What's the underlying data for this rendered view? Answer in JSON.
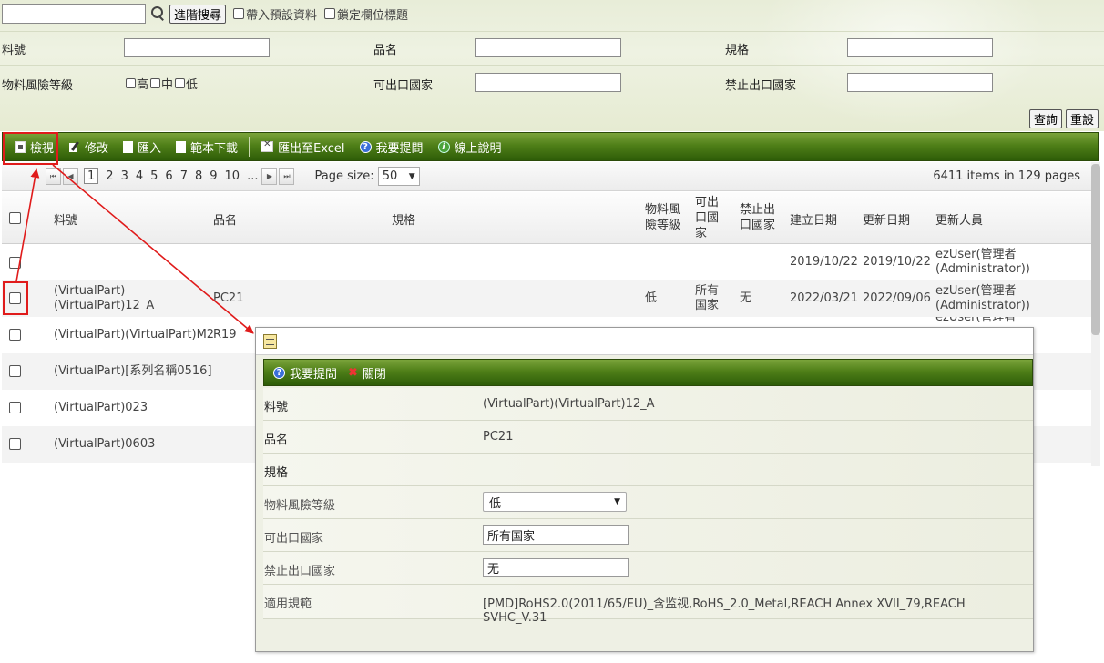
{
  "search": {
    "advanced_button": "進階搜尋",
    "opt_default": "帶入預設資料",
    "opt_lock": "鎖定欄位標題",
    "fields": {
      "part_no": "料號",
      "name": "品名",
      "spec": "規格",
      "risk": "物料風險等級",
      "risk_high": "高",
      "risk_mid": "中",
      "risk_low": "低",
      "export_ok": "可出口國家",
      "export_ban": "禁止出口國家"
    },
    "query_button": "查詢",
    "reset_button": "重設"
  },
  "toolbar": {
    "view": "檢視",
    "edit": "修改",
    "import": "匯入",
    "template": "範本下載",
    "export": "匯出至Excel",
    "ask": "我要提問",
    "help": "線上說明"
  },
  "pager": {
    "pages": [
      "1",
      "2",
      "3",
      "4",
      "5",
      "6",
      "7",
      "8",
      "9",
      "10",
      "..."
    ],
    "page_size_label": "Page size:",
    "page_size": "50",
    "info": "6411 items in 129 pages"
  },
  "grid": {
    "headers": {
      "part_no": "料號",
      "name": "品名",
      "spec": "規格",
      "risk": "物料風險等級",
      "export_ok": "可出口國家",
      "export_ban": "禁止出口國家",
      "created": "建立日期",
      "updated": "更新日期",
      "updater": "更新人員"
    },
    "rows": [
      {
        "part_no": "",
        "name": "",
        "risk": "",
        "export_ok": "",
        "export_ban": "",
        "created": "2019/10/22",
        "updated": "2019/10/22",
        "updater": "ezUser(管理者 (Administrator))"
      },
      {
        "part_no": "(VirtualPart) (VirtualPart)12_A",
        "name": "PC21",
        "risk": "低",
        "export_ok": "所有国家",
        "export_ban": "无",
        "created": "2022/03/21",
        "updated": "2022/09/06",
        "updater": "ezUser(管理者 (Administrator))"
      },
      {
        "part_no": "(VirtualPart)(VirtualPart)M2",
        "name": "R19",
        "updater": "ezUser(管理者"
      },
      {
        "part_no": "(VirtualPart)[系列名稱0516]"
      },
      {
        "part_no": "(VirtualPart)023"
      },
      {
        "part_no": "(VirtualPart)0603"
      }
    ]
  },
  "dialog": {
    "ask": "我要提問",
    "close": "關閉",
    "rows": [
      {
        "label": "料號",
        "value": "(VirtualPart)(VirtualPart)12_A"
      },
      {
        "label": "品名",
        "value": "PC21"
      },
      {
        "label": "規格",
        "value": ""
      },
      {
        "label": "物料風險等級",
        "value": "低"
      },
      {
        "label": "可出口國家",
        "value": "所有国家"
      },
      {
        "label": "禁止出口國家",
        "value": "无"
      },
      {
        "label": "適用規範",
        "value": "[PMD]RoHS2.0(2011/65/EU)_含监视,RoHS_2.0_Metal,REACH Annex XVII_79,REACH SVHC_V.31"
      }
    ]
  },
  "colors": {
    "toolbar_green": "#4f7f18",
    "highlight_red": "#e01b1b",
    "search_bg": "#e8edd8"
  }
}
